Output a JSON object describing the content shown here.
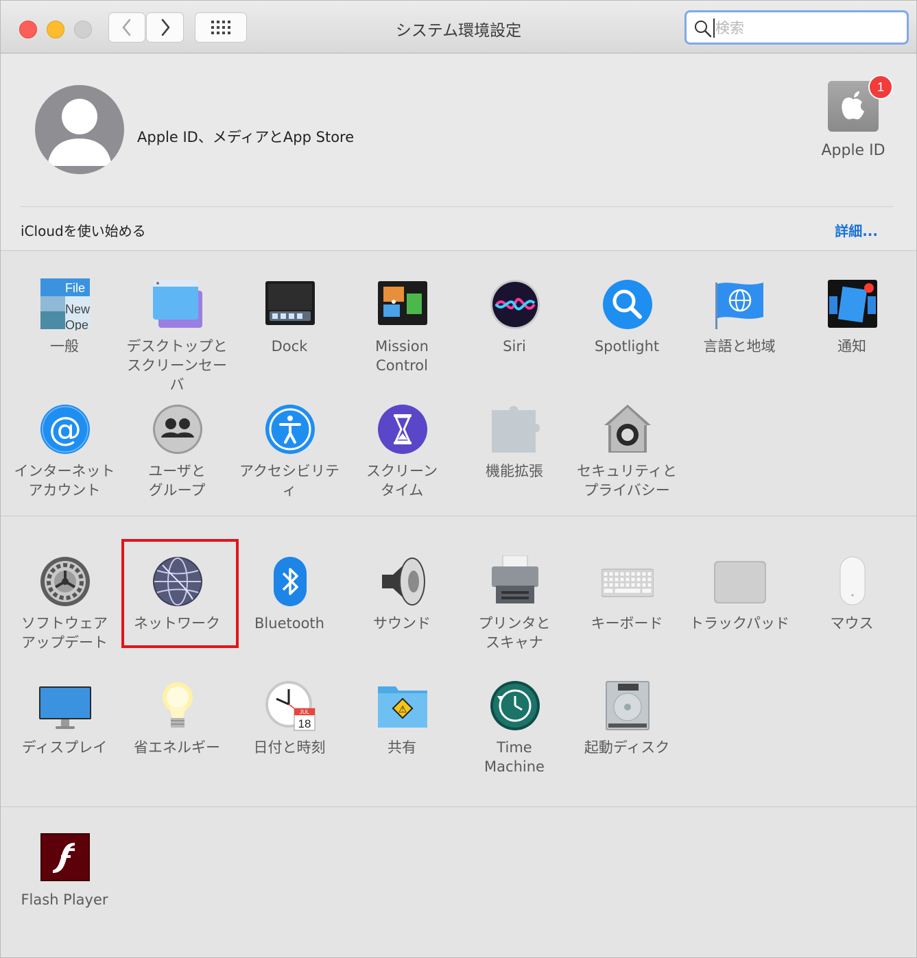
{
  "window": {
    "title": "システム環境設定",
    "search_placeholder": "検索"
  },
  "account": {
    "label": "Apple ID、メディアとApp Store",
    "apple_id_label": "Apple ID",
    "badge_count": "1"
  },
  "icloud": {
    "label": "iCloudを使い始める",
    "more_link": "詳細..."
  },
  "section1": [
    {
      "name": "general",
      "label": "一般",
      "icon": "general-icon"
    },
    {
      "name": "desktop-screensaver",
      "label": "デスクトップと\nスクリーンセーバ",
      "icon": "desktop-screensaver-icon"
    },
    {
      "name": "dock",
      "label": "Dock",
      "icon": "dock-icon"
    },
    {
      "name": "mission-control",
      "label": "Mission\nControl",
      "icon": "mission-control-icon"
    },
    {
      "name": "siri",
      "label": "Siri",
      "icon": "siri-icon"
    },
    {
      "name": "spotlight",
      "label": "Spotlight",
      "icon": "spotlight-icon"
    },
    {
      "name": "language-region",
      "label": "言語と地域",
      "icon": "language-region-icon"
    },
    {
      "name": "notifications",
      "label": "通知",
      "icon": "notifications-icon"
    },
    {
      "name": "internet-accounts",
      "label": "インターネット\nアカウント",
      "icon": "internet-accounts-icon"
    },
    {
      "name": "users-groups",
      "label": "ユーザと\nグループ",
      "icon": "users-groups-icon"
    },
    {
      "name": "accessibility",
      "label": "アクセシビリティ",
      "icon": "accessibility-icon"
    },
    {
      "name": "screen-time",
      "label": "スクリーン\nタイム",
      "icon": "screen-time-icon"
    },
    {
      "name": "extensions",
      "label": "機能拡張",
      "icon": "extensions-icon"
    },
    {
      "name": "security-privacy",
      "label": "セキュリティと\nプライバシー",
      "icon": "security-privacy-icon"
    }
  ],
  "section2": [
    {
      "name": "software-update",
      "label": "ソフトウェア\nアップデート",
      "icon": "software-update-icon"
    },
    {
      "name": "network",
      "label": "ネットワーク",
      "icon": "network-icon"
    },
    {
      "name": "bluetooth",
      "label": "Bluetooth",
      "icon": "bluetooth-icon"
    },
    {
      "name": "sound",
      "label": "サウンド",
      "icon": "sound-icon"
    },
    {
      "name": "printers-scanners",
      "label": "プリンタと\nスキャナ",
      "icon": "printer-icon"
    },
    {
      "name": "keyboard",
      "label": "キーボード",
      "icon": "keyboard-icon"
    },
    {
      "name": "trackpad",
      "label": "トラックパッド",
      "icon": "trackpad-icon"
    },
    {
      "name": "mouse",
      "label": "マウス",
      "icon": "mouse-icon"
    },
    {
      "name": "displays",
      "label": "ディスプレイ",
      "icon": "display-icon"
    },
    {
      "name": "energy-saver",
      "label": "省エネルギー",
      "icon": "energy-saver-icon"
    },
    {
      "name": "date-time",
      "label": "日付と時刻",
      "icon": "date-time-icon",
      "cal_month": "JUL",
      "cal_day": "18"
    },
    {
      "name": "sharing",
      "label": "共有",
      "icon": "sharing-icon"
    },
    {
      "name": "time-machine",
      "label": "Time\nMachine",
      "icon": "time-machine-icon"
    },
    {
      "name": "startup-disk",
      "label": "起動ディスク",
      "icon": "startup-disk-icon"
    }
  ],
  "section3": [
    {
      "name": "flash-player",
      "label": "Flash Player",
      "icon": "flash-player-icon"
    }
  ],
  "general_icon_text": [
    "File",
    "New",
    "Ope"
  ],
  "colors": {
    "highlight": "#e3131b",
    "link": "#1a73d8",
    "badge": "#f23b3b"
  }
}
